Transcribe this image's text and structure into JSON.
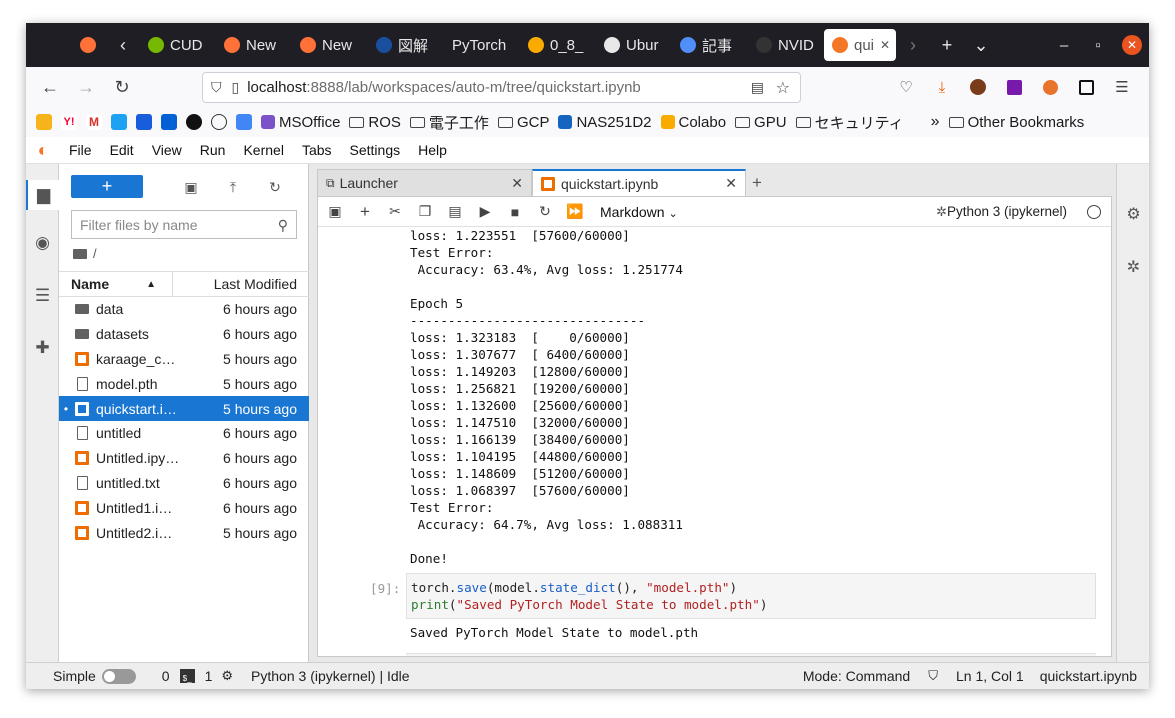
{
  "browser": {
    "tabs": [
      {
        "label": "",
        "color": "#ff7139"
      },
      {
        "label": "CUD",
        "color": "#76b900"
      },
      {
        "label": "New",
        "color": "#ff7139"
      },
      {
        "label": "New",
        "color": "#ff7139"
      },
      {
        "label": "図解",
        "color": "#1a4fa0"
      },
      {
        "label": "PyTorch",
        "color": ""
      },
      {
        "label": "0_8_",
        "color": "#f9ab00"
      },
      {
        "label": "Ubur",
        "color": "#e8e8e8"
      },
      {
        "label": "記事",
        "color": "#4f8ff7"
      },
      {
        "label": "NVID",
        "color": "#333333"
      },
      {
        "label": "qui",
        "color": "#f37726"
      }
    ],
    "url_host": "localhost",
    "url_rest": ":8888/lab/workspaces/auto-m/tree/quickstart.ipynb",
    "bookmarks": [
      {
        "label": "MSOffice",
        "type": "icon"
      },
      {
        "label": "ROS",
        "type": "folder"
      },
      {
        "label": "電子工作",
        "type": "folder"
      },
      {
        "label": "GCP",
        "type": "folder"
      },
      {
        "label": "NAS251D2",
        "type": "icon"
      },
      {
        "label": "Colabo",
        "type": "icon"
      },
      {
        "label": "GPU",
        "type": "folder"
      },
      {
        "label": "セキュリティ",
        "type": "folder"
      }
    ],
    "other_bookmarks": "Other Bookmarks"
  },
  "menu": [
    "File",
    "Edit",
    "View",
    "Run",
    "Kernel",
    "Tabs",
    "Settings",
    "Help"
  ],
  "filebrowser": {
    "filter_placeholder": "Filter files by name",
    "path": "/",
    "col_name": "Name",
    "col_modified": "Last Modified",
    "files": [
      {
        "name": "data",
        "modified": "6 hours ago",
        "type": "folder",
        "selected": false
      },
      {
        "name": "datasets",
        "modified": "6 hours ago",
        "type": "folder",
        "selected": false
      },
      {
        "name": "karaage_c…",
        "modified": "5 hours ago",
        "type": "notebook",
        "selected": false
      },
      {
        "name": "model.pth",
        "modified": "5 hours ago",
        "type": "file",
        "selected": false
      },
      {
        "name": "quickstart.i…",
        "modified": "5 hours ago",
        "type": "notebook",
        "selected": true
      },
      {
        "name": "untitled",
        "modified": "6 hours ago",
        "type": "file",
        "selected": false
      },
      {
        "name": "Untitled.ipy…",
        "modified": "6 hours ago",
        "type": "notebook",
        "selected": false
      },
      {
        "name": "untitled.txt",
        "modified": "6 hours ago",
        "type": "file",
        "selected": false
      },
      {
        "name": "Untitled1.i…",
        "modified": "6 hours ago",
        "type": "notebook",
        "selected": false
      },
      {
        "name": "Untitled2.i…",
        "modified": "5 hours ago",
        "type": "notebook",
        "selected": false
      }
    ]
  },
  "tabs": {
    "launcher": "Launcher",
    "notebook": "quickstart.ipynb"
  },
  "notebook": {
    "cell_type": "Markdown",
    "kernel": "Python 3 (ipykernel)",
    "output_lines": [
      "loss: 1.223551  [57600/60000]",
      "Test Error:",
      " Accuracy: 63.4%, Avg loss: 1.251774",
      "",
      "Epoch 5",
      "-------------------------------",
      "loss: 1.323183  [    0/60000]",
      "loss: 1.307677  [ 6400/60000]",
      "loss: 1.149203  [12800/60000]",
      "loss: 1.256821  [19200/60000]",
      "loss: 1.132600  [25600/60000]",
      "loss: 1.147510  [32000/60000]",
      "loss: 1.166139  [38400/60000]",
      "loss: 1.104195  [44800/60000]",
      "loss: 1.148609  [51200/60000]",
      "loss: 1.068397  [57600/60000]",
      "Test Error:",
      " Accuracy: 64.7%, Avg loss: 1.088311",
      "",
      "Done!"
    ],
    "cell_prompt": "[9]:",
    "code_line1": {
      "a": "torch.",
      "b": "save",
      "c": "(model.",
      "d": "state_dict",
      "e": "(), ",
      "f": "\"model.pth\"",
      "g": ")"
    },
    "code_line2": {
      "a": "print",
      "b": "(",
      "c": "\"Saved PyTorch Model State to model.pth\"",
      "d": ")"
    },
    "cell_output": "Saved PyTorch Model State to model.pth"
  },
  "status": {
    "mode_label": "Simple",
    "count1": "0",
    "count2": "1",
    "kernel_status": "Python 3 (ipykernel) | Idle",
    "mode": "Mode: Command",
    "cursor": "Ln 1, Col 1",
    "file": "quickstart.ipynb"
  },
  "colors": {
    "accent": "#1976d2",
    "jupyter_orange": "#f37726",
    "titlebar": "#1f1e25"
  }
}
